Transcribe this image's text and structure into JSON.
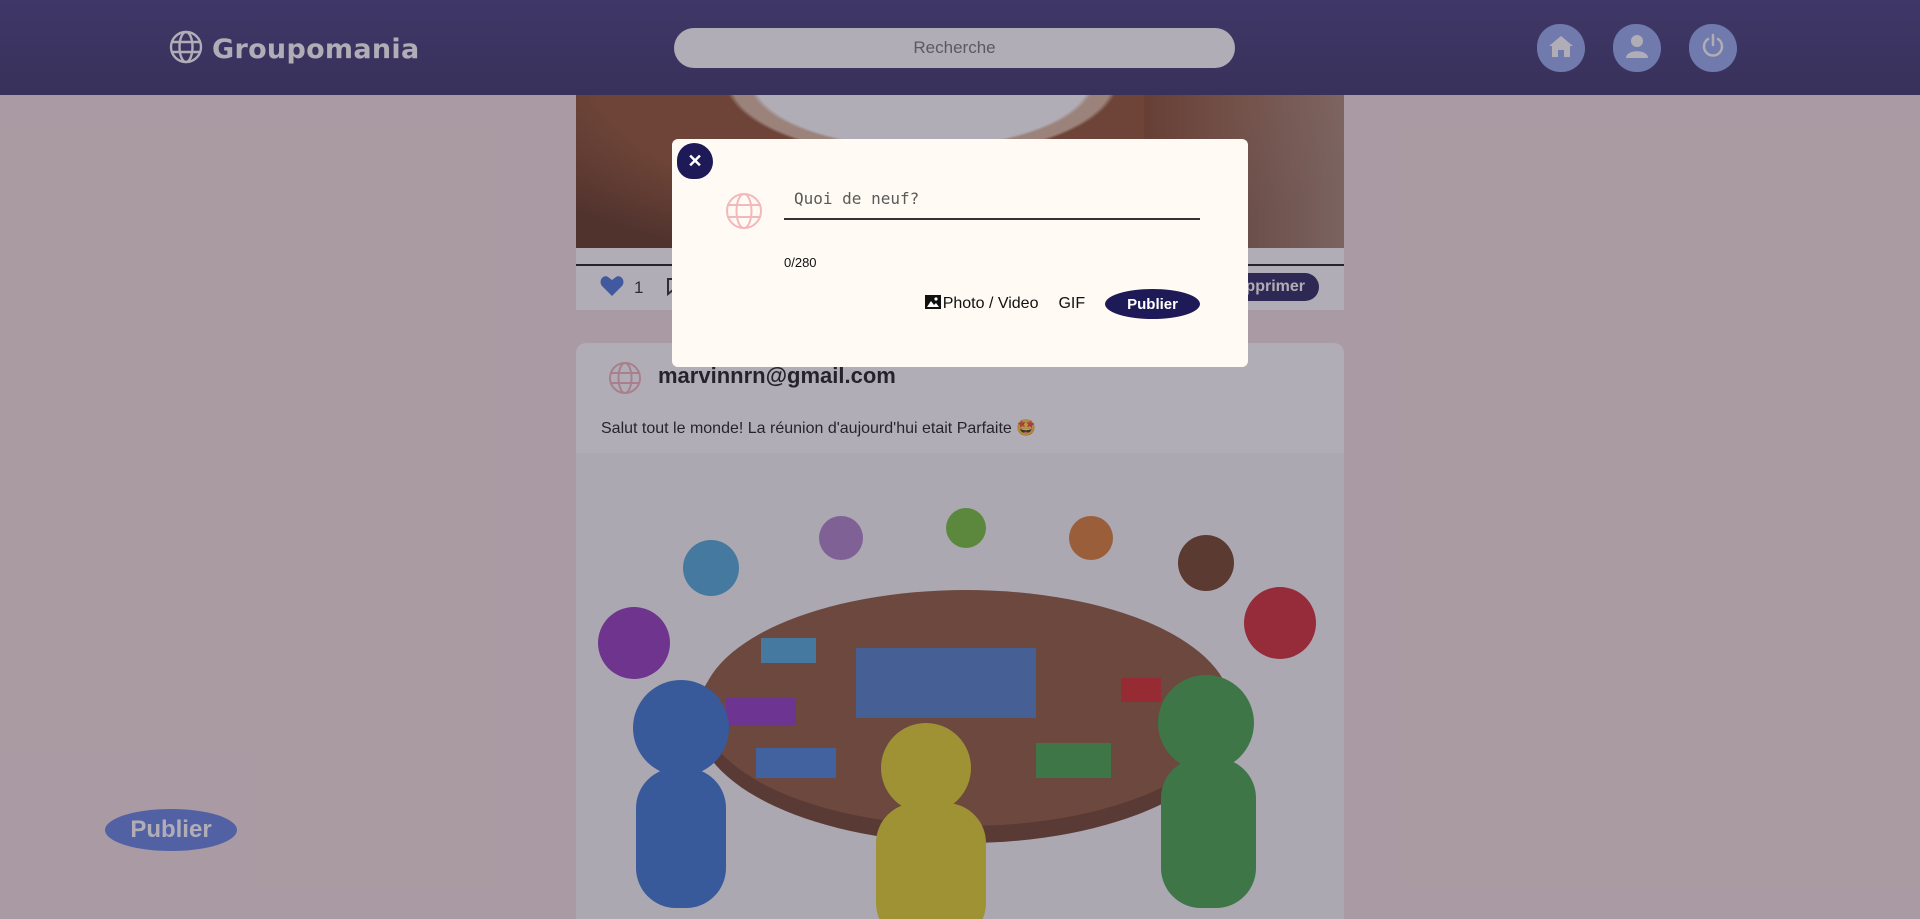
{
  "header": {
    "brand": "Groupomania",
    "search_placeholder": "Recherche",
    "icons": [
      "home-icon",
      "user-icon",
      "power-icon"
    ]
  },
  "feed": {
    "top_post": {
      "likes": "1",
      "delete_label": "Supprimer"
    },
    "post": {
      "author": "marvinnrn@gmail.com",
      "text": "Salut tout le monde! La réunion d'aujourd'hui etait Parfaite 🤩"
    }
  },
  "floating_publish": "Publier",
  "modal": {
    "placeholder": "Quoi de neuf?",
    "counter": "0/280",
    "photo_label": "Photo / Video",
    "gif_label": "GIF",
    "publish_label": "Publier",
    "close_label": "✕"
  },
  "colors": {
    "header": "#2f2a62",
    "accent": "#1e1a57",
    "light_button": "#8fa8ee"
  }
}
